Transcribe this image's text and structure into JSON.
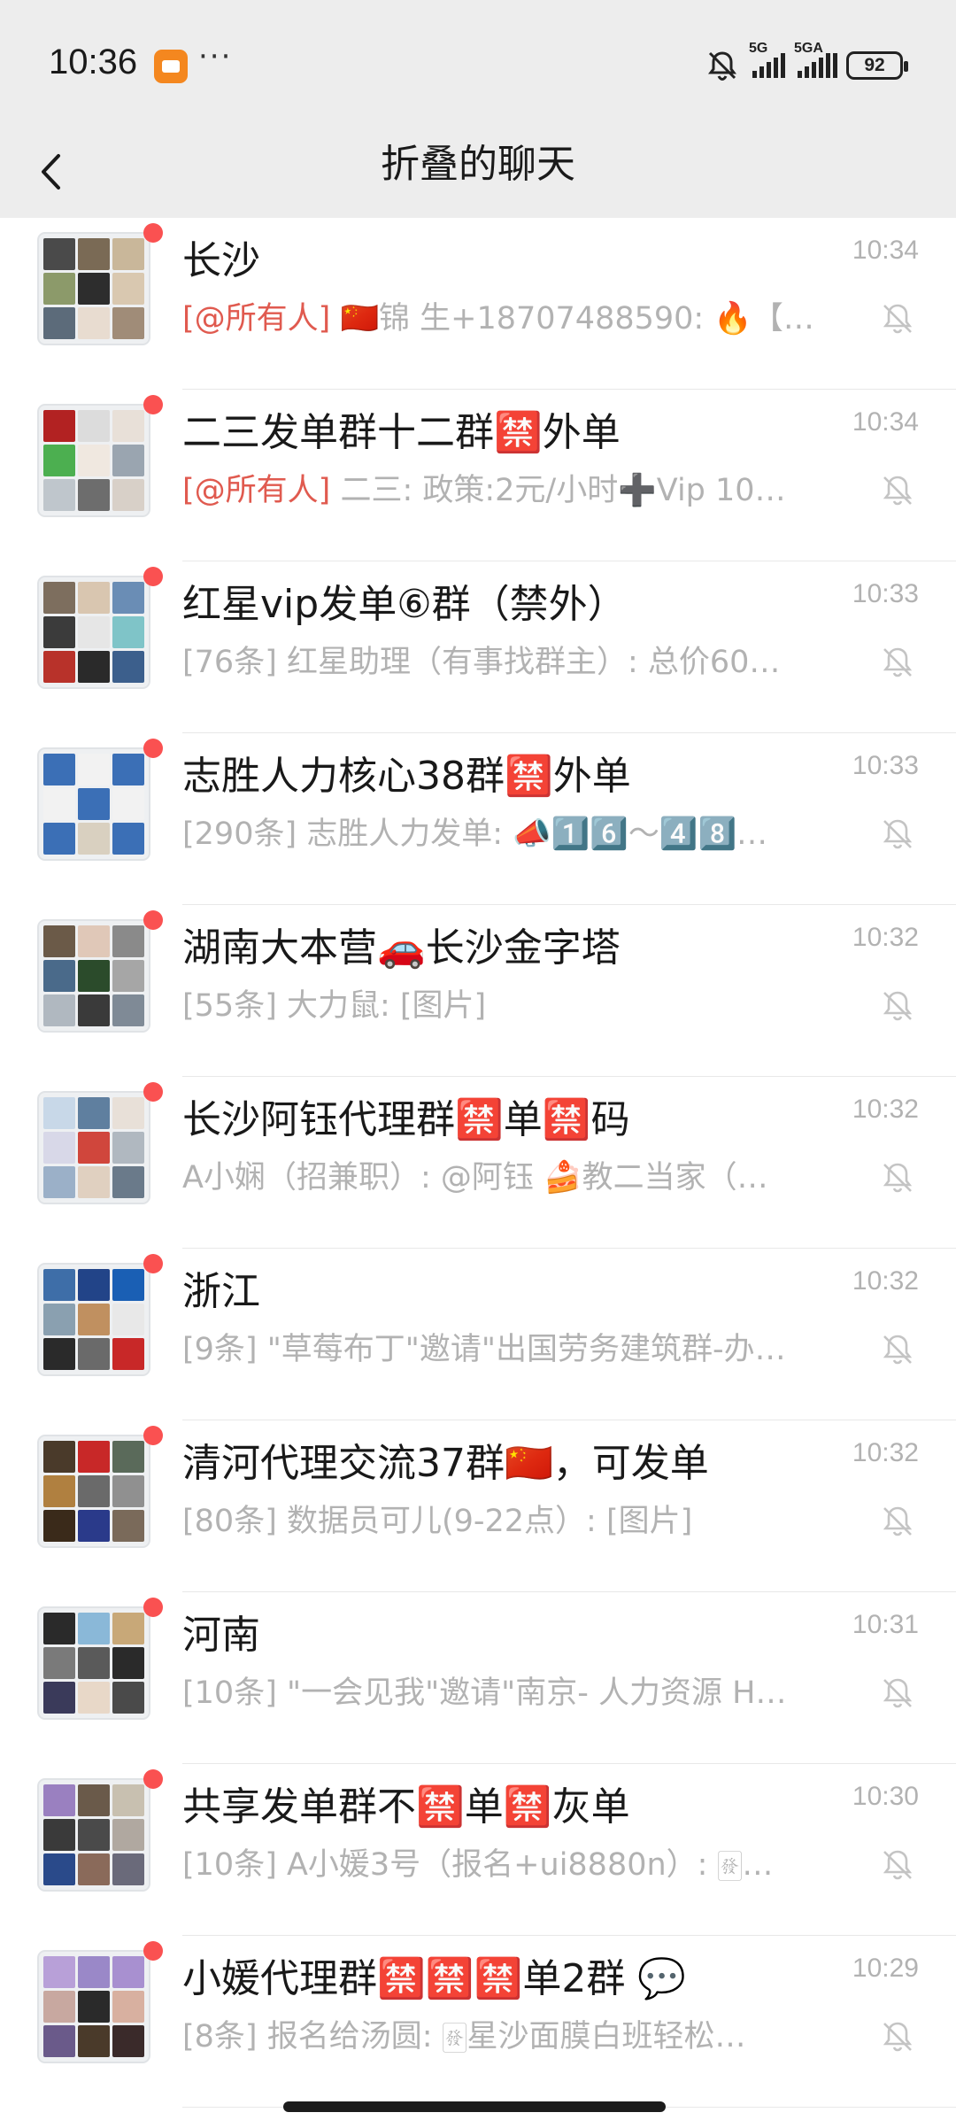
{
  "status_bar": {
    "time": "10:36",
    "dots": "···",
    "sim1_label": "5G",
    "sim2_label": "5GA",
    "battery": "92"
  },
  "header": {
    "title": "折叠的聊天",
    "back_icon": "chevron-left-icon"
  },
  "chats": [
    {
      "title": "长沙",
      "mention": "[@所有人]",
      "preview": " 🇨🇳锦 生+18707488590: 🔥【…",
      "time": "10:34"
    },
    {
      "title": "二三发单群十二群🈲外单",
      "mention": "[@所有人]",
      "preview": " 二三: 政策:2元/小时➕Vip  10…",
      "time": "10:34"
    },
    {
      "title": "红星vip发单⑥群（禁外）",
      "mention": "",
      "preview": "[76条] 红星助理（有事找群主）: 总价60…",
      "time": "10:33"
    },
    {
      "title": "志胜人力核心38群🈲外单",
      "mention": "",
      "preview": "[290条] 志胜人力发单: 📣1️⃣6️⃣～4️⃣8️⃣…",
      "time": "10:33"
    },
    {
      "title": "湖南大本营🚗长沙金字塔",
      "mention": "",
      "preview": "[55条] 大力鼠: [图片]",
      "time": "10:32"
    },
    {
      "title": "长沙阿钰代理群🈲单🈲码",
      "mention": "",
      "preview": "A小娴（招兼职）: @阿钰   🍰教二当家（…",
      "time": "10:32"
    },
    {
      "title": "浙江",
      "mention": "",
      "preview": "[9条] \"草莓布丁\"邀请\"出国劳务建筑群-办…",
      "time": "10:32"
    },
    {
      "title": "清河代理交流37群🇨🇳，可发单",
      "mention": "",
      "preview": "[80条] 数据员可儿(9-22点）: [图片]",
      "time": "10:32"
    },
    {
      "title": "河南",
      "mention": "",
      "preview": "[10条] \"一会见我\"邀请\"南京- 人力资源 H…",
      "time": "10:31"
    },
    {
      "title": "共享发单群不🈲单🈲灰单",
      "mention": "",
      "preview": "[10条] A小媛3号（报名+ui8880n）: 🀅…",
      "time": "10:30"
    },
    {
      "title": "小媛代理群🈲🈲🈲单2群 💬",
      "mention": "",
      "preview": "[8条] 报名给汤圆: 🀅星沙面膜白班轻松…",
      "time": "10:29"
    }
  ],
  "colors": {
    "unread_dot": "#fa5151",
    "mention": "#e05a4f",
    "header_bg": "#ededed",
    "secondary_text": "#b2b2b2"
  }
}
